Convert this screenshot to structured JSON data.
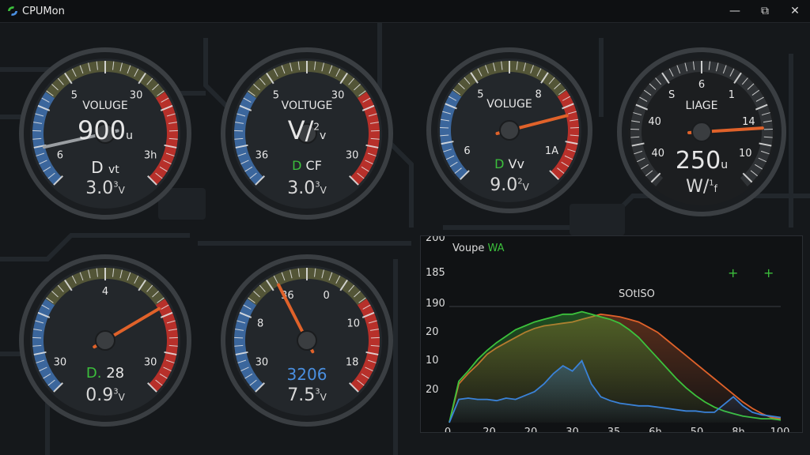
{
  "window": {
    "title": "CPUMon",
    "minimize": "—",
    "restore": "⧉",
    "close": "✕"
  },
  "gauges": [
    {
      "title": "VOLUGE",
      "main": "900",
      "main_unit": "u",
      "sub1_a": "D",
      "sub1_b": "vt",
      "sub2": "3.0",
      "sub2_sup": "3",
      "sub2_unit": "V",
      "ticks": [
        "6",
        "5",
        "30",
        "3h"
      ],
      "needle_pct": 0.12
    },
    {
      "title": "VOLTUGE",
      "main": "V/",
      "main_sup": "2",
      "main_unit": "v",
      "sub1_a": "D",
      "sub1_b": "CF",
      "sub2": "3.0",
      "sub2_sup": "3",
      "sub2_unit": "V",
      "ticks": [
        "36",
        "5",
        "30",
        "30"
      ]
    },
    {
      "title": "VOLUGE",
      "main": "",
      "sub1_a": "D",
      "sub1_b": "Vv",
      "sub2": "9.0",
      "sub2_sup": "2",
      "sub2_unit": "V",
      "ticks": [
        "6",
        "5",
        "8",
        "1A"
      ],
      "needle_pct": 0.78
    },
    {
      "title": "LIAGE",
      "main": "250",
      "main_unit": "u",
      "sub2": "W/",
      "sub2_sup": "1",
      "sub2_unit": "f",
      "ticks": [
        "40",
        "40",
        "S",
        "6",
        "1",
        "14",
        "10"
      ],
      "needle_pct": 0.82
    },
    {
      "title": "",
      "main": "",
      "sub1_a": "D.",
      "sub1_b": "28",
      "sub2": "0.9",
      "sub2_sup": "3",
      "sub2_unit": "V",
      "ticks": [
        "30",
        "4",
        "30"
      ],
      "needle_pct": 0.72
    },
    {
      "title": "",
      "main": "",
      "sub1_a": "3206",
      "sub2": "7.5",
      "sub2_sup": "3",
      "sub2_unit": "V",
      "ticks": [
        "30",
        "8",
        "36",
        "0",
        "10",
        "18"
      ],
      "needle_pct": 0.4
    }
  ],
  "chart_data": {
    "type": "area",
    "title": "Voupe WA",
    "annotation": "SOtISO",
    "legend": [
      "+",
      "+"
    ],
    "x_ticks": [
      "0",
      "20",
      "20",
      "30",
      "35",
      "6h",
      "50",
      "8h",
      "100"
    ],
    "y_ticks": [
      "200",
      "185",
      "190",
      "20",
      "10",
      "20"
    ],
    "series": [
      {
        "color": "#e0622a",
        "values": [
          0,
          30,
          38,
          45,
          53,
          58,
          62,
          66,
          70,
          73,
          75,
          76,
          77,
          78,
          80,
          82,
          84,
          83,
          82,
          80,
          78,
          74,
          70,
          64,
          58,
          52,
          46,
          40,
          34,
          28,
          22,
          16,
          11,
          7,
          4,
          3
        ]
      },
      {
        "color": "#3cc23c",
        "values": [
          0,
          32,
          40,
          49,
          56,
          62,
          67,
          72,
          75,
          78,
          80,
          82,
          84,
          84,
          86,
          84,
          82,
          80,
          77,
          72,
          66,
          58,
          50,
          42,
          34,
          27,
          21,
          16,
          12,
          9,
          7,
          5,
          4,
          3,
          3,
          2
        ]
      },
      {
        "color": "#3a82d8",
        "values": [
          0,
          18,
          19,
          18,
          18,
          17,
          19,
          18,
          21,
          24,
          30,
          38,
          44,
          40,
          48,
          30,
          20,
          17,
          15,
          14,
          13,
          13,
          12,
          11,
          10,
          9,
          9,
          8,
          8,
          14,
          20,
          13,
          8,
          6,
          5,
          4
        ]
      }
    ]
  },
  "colors": {
    "blue": "#3e6ea8",
    "red": "#c8322a",
    "green": "#3cbf3c",
    "orange": "#e0622a",
    "accent_blue": "#4a8fe0"
  }
}
